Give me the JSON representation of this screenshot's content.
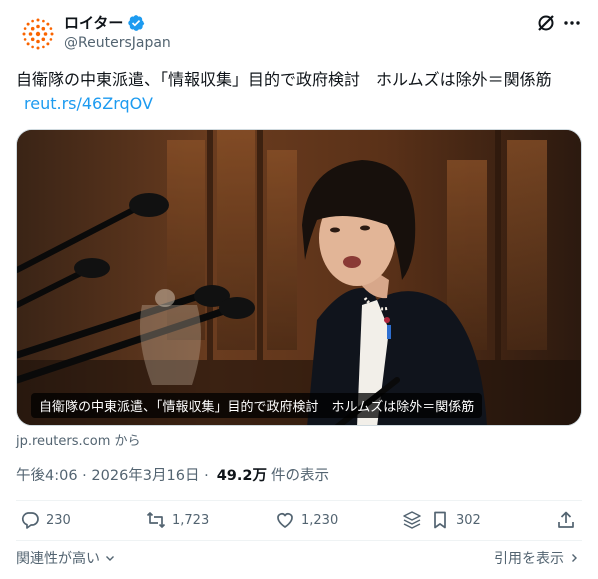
{
  "account": {
    "display_name": "ロイター",
    "handle": "@ReutersJapan",
    "verified": true,
    "brand_color": "#fa6400"
  },
  "tweet": {
    "text": "自衛隊の中東派遣、「情報収集」目的で政府検討　ホルムズは除外＝関係筋",
    "link": "reut.rs/46ZrqOV"
  },
  "card": {
    "caption": "自衛隊の中東派遣、「情報収集」目的で政府検討　ホルムズは除外＝関係筋",
    "source": "jp.reuters.com から"
  },
  "meta": {
    "timestamp": "午後4:06 · 2026年3月16日 ·",
    "views_count": "49.2万",
    "views_label": "件の表示"
  },
  "actions": {
    "replies": "230",
    "reposts": "1,723",
    "likes": "1,230",
    "bookmarks": "302"
  },
  "footer": {
    "sort_label": "関連性が高い",
    "quotes_label": "引用を表示"
  },
  "icons": {
    "verified": "verified-badge-icon",
    "grok": "grok-icon",
    "more": "more-icon",
    "reply": "reply-icon",
    "repost": "repost-icon",
    "like": "heart-icon",
    "bookmark": "bookmark-icon",
    "share": "share-icon"
  }
}
